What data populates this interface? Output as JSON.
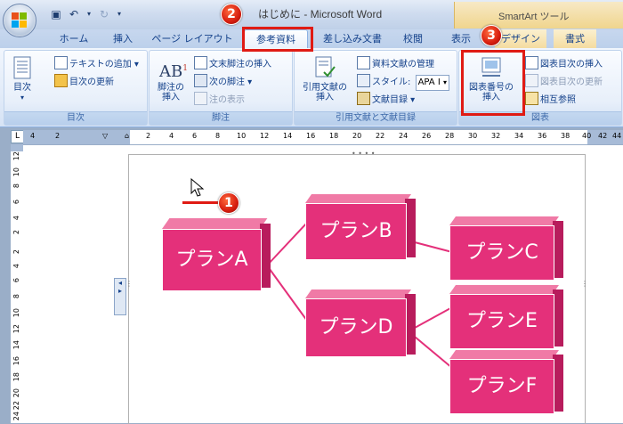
{
  "window": {
    "title": "はじめに - Microsoft Word",
    "contextual_title": "SmartArt ツール"
  },
  "tabs": [
    "ホーム",
    "挿入",
    "ページ レイアウト",
    "参考資料",
    "差し込み文書",
    "校閲",
    "表示",
    "デザイン",
    "書式"
  ],
  "ribbon": {
    "toc_group": {
      "label": "目次",
      "toc_button": "目次",
      "add_text": "テキストの追加",
      "update_toc": "目次の更新"
    },
    "footnote_group": {
      "label": "脚注",
      "insert_footnote": "脚注の\n挿入",
      "insert_endnote": "文末脚注の挿入",
      "next_footnote": "次の脚注",
      "show_notes": "注の表示",
      "ab_glyph": "AB"
    },
    "citation_group": {
      "label": "引用文献と文献目録",
      "insert_citation": "引用文献の\n挿入",
      "manage_sources": "資料文献の管理",
      "style_label": "スタイル:",
      "style_value": "APA I",
      "bibliography": "文献目録"
    },
    "caption_group": {
      "label": "図表",
      "insert_caption": "図表番号の\n挿入",
      "insert_table_of_figures": "図表目次の挿入",
      "update_table": "図表目次の更新",
      "cross_reference": "相互参照"
    }
  },
  "ruler": {
    "h_numbers": [
      "4",
      "2",
      "2",
      "4",
      "6",
      "8",
      "10",
      "12",
      "14",
      "16",
      "18",
      "20",
      "22",
      "24",
      "26",
      "28",
      "30",
      "32",
      "34",
      "36",
      "38",
      "40",
      "42",
      "44"
    ],
    "v_numbers": [
      "12",
      "10",
      "8",
      "6",
      "4",
      "2",
      "2",
      "4",
      "6",
      "8",
      "10",
      "12",
      "14",
      "16",
      "18",
      "20",
      "22",
      "24"
    ]
  },
  "smartart": {
    "nodes": {
      "a": "プランA",
      "b": "プランB",
      "c": "プランC",
      "d": "プランD",
      "e": "プランE",
      "f": "プランF"
    },
    "color": "#e4307a"
  },
  "callouts": [
    "1",
    "2",
    "3"
  ],
  "accent": {
    "highlight": "#e01b14"
  }
}
